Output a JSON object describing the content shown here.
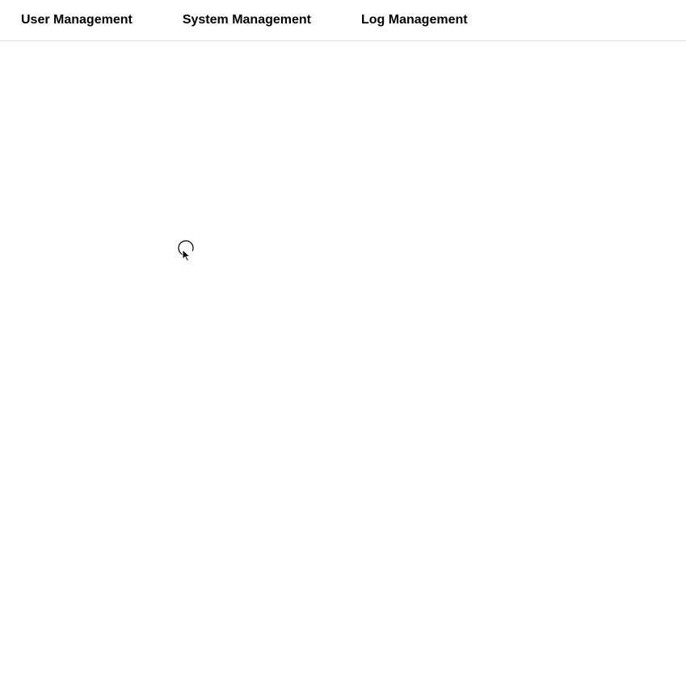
{
  "nav": {
    "items": [
      {
        "label": "User Management"
      },
      {
        "label": "System Management"
      },
      {
        "label": "Log Management"
      }
    ]
  }
}
